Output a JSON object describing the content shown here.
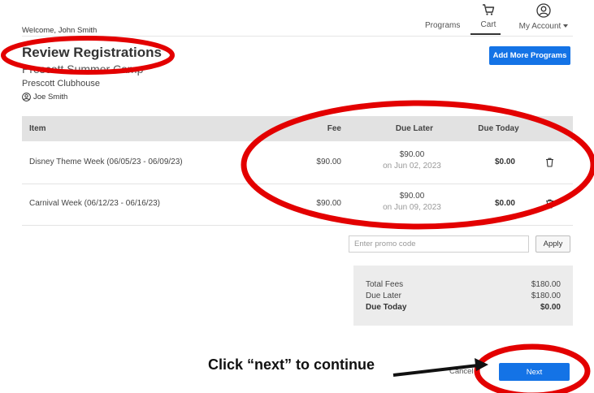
{
  "header": {
    "welcome": "Welcome, John Smith",
    "nav": {
      "programs": "Programs",
      "cart": "Cart",
      "account": "My Account"
    }
  },
  "page": {
    "title": "Review Registrations",
    "program_name": "Prescott Summer Camp",
    "location": "Prescott Clubhouse",
    "participant": "Joe Smith",
    "add_more_label": "Add More Programs"
  },
  "table": {
    "columns": {
      "item": "Item",
      "fee": "Fee",
      "due_later": "Due Later",
      "due_today": "Due Today"
    },
    "rows": [
      {
        "item": "Disney Theme Week (06/05/23 - 06/09/23)",
        "fee": "$90.00",
        "due_later": "$90.00",
        "due_later_date": "on Jun 02, 2023",
        "due_today": "$0.00"
      },
      {
        "item": "Carnival Week (06/12/23 - 06/16/23)",
        "fee": "$90.00",
        "due_later": "$90.00",
        "due_later_date": "on Jun 09, 2023",
        "due_today": "$0.00"
      }
    ]
  },
  "promo": {
    "placeholder": "Enter promo code",
    "apply_label": "Apply"
  },
  "summary": {
    "total_fees_label": "Total Fees",
    "total_fees": "$180.00",
    "due_later_label": "Due Later",
    "due_later": "$180.00",
    "due_today_label": "Due Today",
    "due_today": "$0.00"
  },
  "footer": {
    "cancel_label": "Cancel",
    "next_label": "Next"
  },
  "annotation": {
    "instruction": "Click “next” to continue"
  },
  "colors": {
    "primary_button": "#1473e6",
    "annotation_red": "#e30000",
    "table_header_bg": "#e2e2e2"
  }
}
